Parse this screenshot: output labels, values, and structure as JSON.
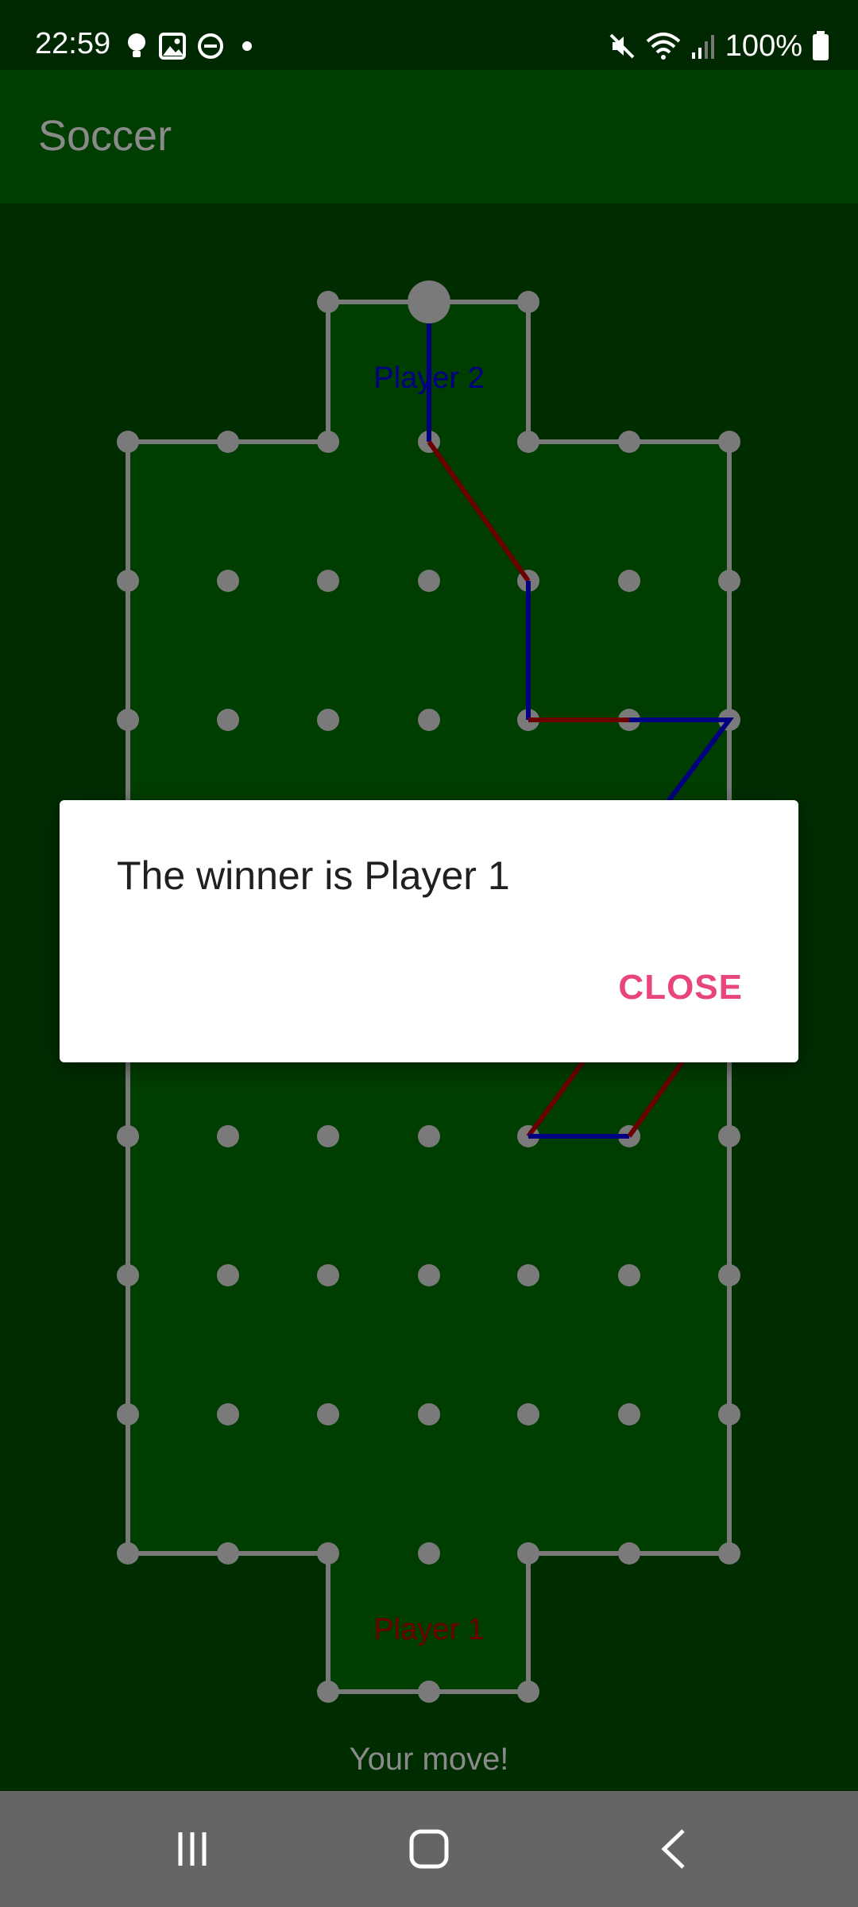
{
  "status_bar": {
    "time": "22:59",
    "left_icons": [
      "bulb-icon",
      "image-icon",
      "do-not-disturb-icon",
      "dot-icon"
    ],
    "right_icons": [
      "mute-icon",
      "wifi-icon",
      "signal-icon"
    ],
    "battery": "100%"
  },
  "app_bar": {
    "title": "Soccer"
  },
  "field": {
    "player2_label": "Player 2",
    "player1_label": "Player 1",
    "player1_color": "#6b0000",
    "player2_color": "#000080",
    "status_text": "Your move!"
  },
  "dialog": {
    "message": "The winner is Player 1",
    "close_label": "CLOSE",
    "accent": "#e8457a"
  },
  "nav_bar": {
    "buttons": [
      "recents-icon",
      "home-icon",
      "back-icon"
    ]
  }
}
